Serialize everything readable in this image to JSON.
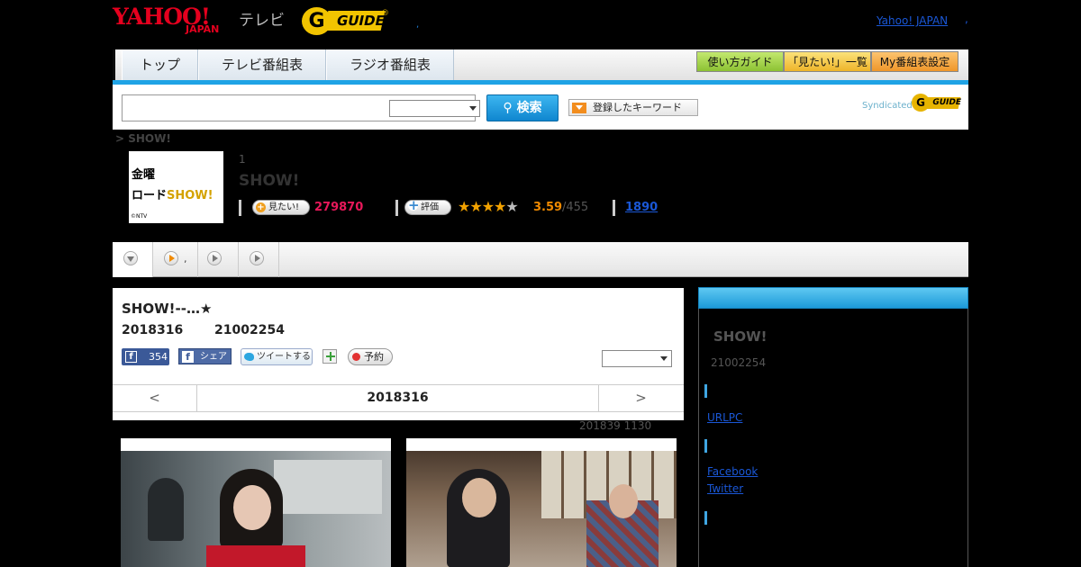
{
  "header": {
    "logo_main": "YAHOO!",
    "logo_sub": "JAPAN",
    "logo_tv": "テレビ",
    "gguide_g": "G",
    "gguide_text": "GUIDE",
    "gguide_reg": "®",
    "separator": ",",
    "yahoo_link": "Yahoo! JAPAN",
    "yahoo_link_suffix": ","
  },
  "nav": {
    "tabs": [
      "トップ",
      "テレビ番組表",
      "ラジオ番組表"
    ],
    "guide_buttons": [
      {
        "label": "使い方ガイド",
        "color": "#a6d64a"
      },
      {
        "label": "「見たい!」一覧",
        "color": "#f3c43e"
      },
      {
        "label": "My番組表設定",
        "color": "#f3a83a"
      }
    ],
    "accent_color": "#1fa3e5"
  },
  "search": {
    "input_value": "",
    "select_value": "",
    "button_label": "検索",
    "keyword_button": "登録したキーワード",
    "syndicated": "Syndicated",
    "syndicated_logo": "GUIDE"
  },
  "breadcrumb": "> SHOW!",
  "show": {
    "thumb_line1": "金曜",
    "thumb_line2a": "ロード",
    "thumb_line2b": "SHOW!",
    "thumb_credit": "©NTV",
    "episode": "1",
    "title": "SHOW!",
    "mitai_label": "見たい!",
    "mitai_count": "279870",
    "rate_label": "評価",
    "stars_on": 3.5,
    "rating": "3.59",
    "rating_count": "/455",
    "link_count": "1890"
  },
  "subtabs": [
    {
      "label": "",
      "icon": "down-circle-icon",
      "active": true
    },
    {
      "label": ",",
      "icon": "play-circle-orange-icon"
    },
    {
      "label": "",
      "icon": "play-circle-icon"
    },
    {
      "label": "",
      "icon": "play-circle-icon"
    }
  ],
  "program": {
    "title": "SHOW!--…★",
    "date": "2018316",
    "time": "21002254",
    "like_count": "354",
    "share_label": "シェア",
    "tweet_label": "ツイートする",
    "reserve_label": "予約",
    "select_value": "",
    "pager_prev": "<",
    "pager_center": "2018316",
    "pager_next": ">",
    "updated": "201839  1130"
  },
  "sidebar": {
    "title": "SHOW!",
    "time": "21002254",
    "link_url": "URLPC",
    "facebook": "Facebook",
    "twitter": "Twitter"
  }
}
